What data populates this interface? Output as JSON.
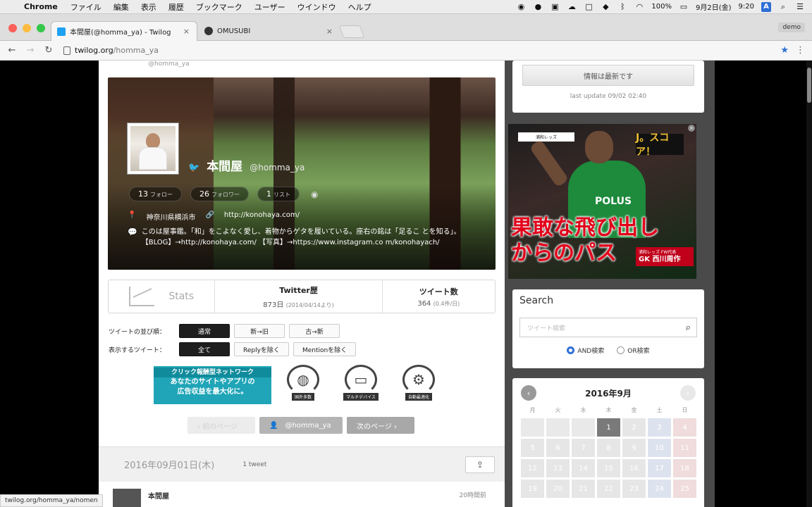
{
  "menubar": {
    "app": "Chrome",
    "items": [
      "ファイル",
      "編集",
      "表示",
      "履歴",
      "ブックマーク",
      "ユーザー",
      "ウインドウ",
      "ヘルプ"
    ],
    "battery": "100%",
    "date": "9月2日(金)",
    "time": "9:20",
    "input_badge": "A"
  },
  "tabs": [
    {
      "title": "本間屋(@homma_ya) - Twilog",
      "active": true
    },
    {
      "title": "OMUSUBI",
      "active": false
    }
  ],
  "profile_label": "demo",
  "address": {
    "host": "twilog.org",
    "path": "/homma_ya"
  },
  "profile": {
    "cut_handle": "@homma_ya",
    "name": "本間屋",
    "handle": "@homma_ya",
    "follow_count": "13",
    "follow_label": "フォロー",
    "follower_count": "26",
    "follower_label": "フォロワー",
    "list_count": "1",
    "list_label": "リスト",
    "location": "神奈川県横浜市",
    "url": "http://konohaya.com/",
    "bio": "このは屋事鑑。「和」をこよなく愛し、着物からゲタを履いている。座右の銘は「足るこ とを知る」。【BLOG】→http://konohaya.com/ 【写真】→https://www.instagram.co m/konohayach/"
  },
  "stats": {
    "stats_label": "Stats",
    "twitter_label": "Twitter歴",
    "twitter_value": "873日",
    "twitter_sub": "(2014/04/14より)",
    "tweets_label": "ツイート数",
    "tweets_value": "364",
    "tweets_sub": "(0.4件/日)"
  },
  "options": {
    "order_label": "ツイートの並び順：",
    "order_buttons": [
      "通常",
      "新→旧",
      "古→新"
    ],
    "show_label": "表示するツイート：",
    "show_buttons": [
      "全て",
      "Replyを除く",
      "Mentionを除く"
    ]
  },
  "promo": {
    "banner_top": "クリック報酬型ネットワーク",
    "banner_line1": "あなたのサイトやアプリの",
    "banner_line2": "広告収益を最大化に。",
    "circle_tags": [
      "国外多数",
      "マルチデバイス",
      "自動最適化"
    ]
  },
  "pager": {
    "prev": "‹ 前のページ",
    "user": "@homma_ya",
    "next": "次のページ ›"
  },
  "day": {
    "date": "2016年09月01日(木)",
    "count": "1 tweet",
    "user": "本間屋",
    "ago": "20時間前"
  },
  "sidebar": {
    "update_button": "情報は最新です",
    "last_update": "last update 09/02 02:40",
    "ad": {
      "team": "浦和レッズ",
      "logo": "J。スコア！",
      "jersey": "POLUS",
      "headline1": "果敢な飛び出し",
      "headline2": "からのパス",
      "credit_top": "浦和レッズ FW代表",
      "credit_name": "GK 西川周作"
    },
    "search": {
      "title": "Search",
      "placeholder": "ツイート検索",
      "and_label": "AND検索",
      "or_label": "OR検索"
    },
    "calendar": {
      "month": "2016年9月",
      "weekdays": [
        "月",
        "火",
        "水",
        "木",
        "金",
        "土",
        "日"
      ],
      "days": [
        "",
        "",
        "",
        "1",
        "2",
        "3",
        "4",
        "5",
        "6",
        "7",
        "8",
        "9",
        "10",
        "11",
        "12",
        "13",
        "14",
        "15",
        "16",
        "17",
        "18",
        "19",
        "20",
        "21",
        "22",
        "23",
        "24",
        "25"
      ],
      "has_tweets": [
        "1"
      ]
    }
  },
  "status_url": "twilog.org/homma_ya/nomen"
}
